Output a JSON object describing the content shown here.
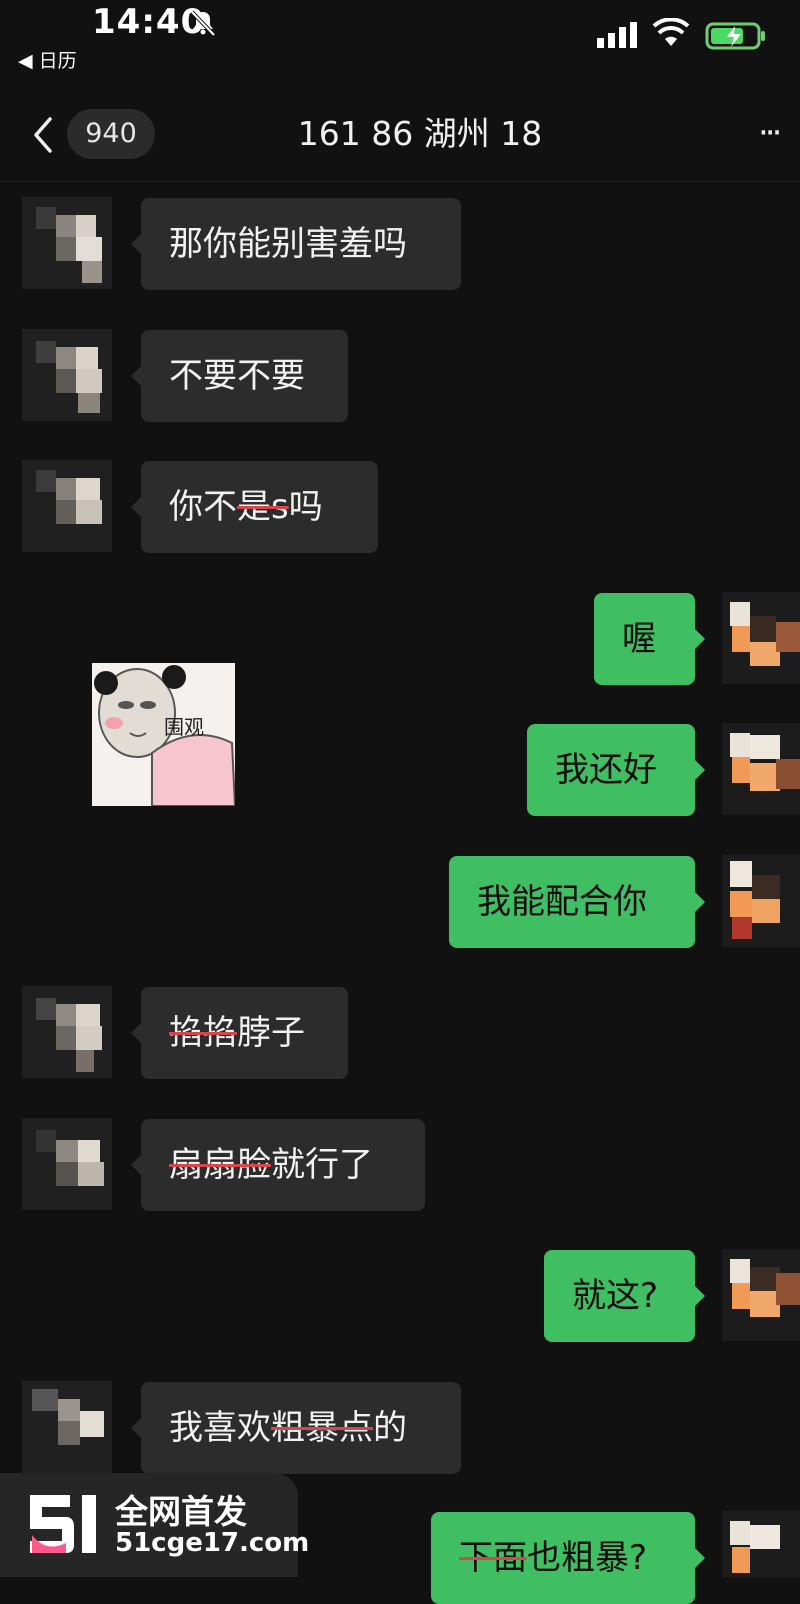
{
  "status_bar": {
    "time": "14:40",
    "back_app_label": "◀ 日历"
  },
  "nav": {
    "unread_count": "940",
    "chat_title": "161 86  湖州 18",
    "more_label": "···"
  },
  "messages": [
    {
      "side": "left",
      "text": "那你能别害羞吗"
    },
    {
      "side": "left",
      "text": "不要不要"
    },
    {
      "side": "left",
      "text_plain": "你不",
      "text_struck": "是s",
      "text_tail": "吗"
    },
    {
      "side": "right",
      "text": "喔"
    },
    {
      "side": "left",
      "type": "sticker",
      "sticker_text": "围观"
    },
    {
      "side": "right",
      "text": "我还好"
    },
    {
      "side": "right",
      "text": "我能配合你"
    },
    {
      "side": "left",
      "text_struck": "掐掐",
      "text_tail": "脖子"
    },
    {
      "side": "left",
      "text_struck": "扇扇脸",
      "text_tail": "就行了"
    },
    {
      "side": "right",
      "text": "就这?"
    },
    {
      "side": "left",
      "text_plain": "我喜欢",
      "text_struck": "粗暴点",
      "text_tail": "的"
    },
    {
      "side": "right",
      "text_struck": "下面",
      "text_tail": "也粗暴?"
    }
  ],
  "watermark": {
    "line1": "全网首发",
    "line2": "51cge17.com"
  },
  "colors": {
    "background": "#111111",
    "incoming_bubble": "#2c2c2c",
    "outgoing_bubble": "#3fbf62",
    "strike": "#d9454b"
  }
}
